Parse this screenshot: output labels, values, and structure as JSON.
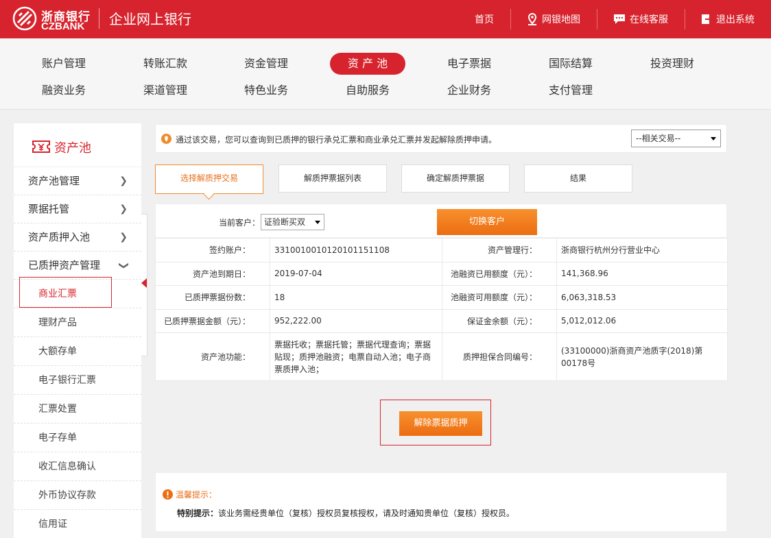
{
  "brand": {
    "name_cn": "浙商银行",
    "name_en": "CZBANK",
    "app_title": "企业网上银行",
    "color": "#d7232d"
  },
  "topnav": [
    {
      "label": "首页",
      "icon": ""
    },
    {
      "label": "网银地图",
      "icon": "location-icon"
    },
    {
      "label": "在线客服",
      "icon": "chat-icon"
    },
    {
      "label": "退出系统",
      "icon": "logout-icon"
    }
  ],
  "mainnav": [
    "账户管理",
    "转账汇款",
    "资金管理",
    "资 产 池",
    "电子票据",
    "国际结算",
    "投资理财",
    "融资业务",
    "渠道管理",
    "特色业务",
    "自助服务",
    "企业财务",
    "支付管理"
  ],
  "sidebar": {
    "title": "资产池",
    "items": [
      "资产池管理",
      "票据托管",
      "资产质押入池",
      "已质押资产管理"
    ],
    "subitems": [
      "商业汇票",
      "理财产品",
      "大额存单",
      "电子银行汇票",
      "汇票处置",
      "电子存单",
      "收汇信息确认",
      "外币协议存款",
      "信用证"
    ]
  },
  "notice": {
    "text": "通过该交易，您可以查询到已质押的银行承兑汇票和商业承兑汇票并发起解除质押申请。",
    "related": "--相关交易--"
  },
  "steps": [
    "选择解质押交易",
    "解质押票据列表",
    "确定解质押票据",
    "结果"
  ],
  "customer": {
    "label": "当前客户：",
    "value": "证验断买双",
    "switch_label": "切换客户"
  },
  "info": {
    "r1": {
      "l1": "签约账户：",
      "v1": "3310010010120101151108",
      "l2": "资产管理行：",
      "v2": "浙商银行杭州分行营业中心"
    },
    "r2": {
      "l1": "资产池到期日：",
      "v1": "2019-07-04",
      "l2": "池融资已用额度（元）：",
      "v2": "141,368.96"
    },
    "r3": {
      "l1": "已质押票据份数：",
      "v1": "18",
      "l2": "池融资可用额度（元）：",
      "v2": "6,063,318.53"
    },
    "r4": {
      "l1": "已质押票据金额（元）：",
      "v1": "952,222.00",
      "l2": "保证金余额（元）：",
      "v2": "5,012,012.06"
    },
    "r5": {
      "l1": "资产池功能：",
      "v1": "票据托收；票据托管；票据代理查询；票据贴现；质押池融资；电票自动入池；电子商票质押入池；",
      "l2": "质押担保合同编号：",
      "v2": "(33100000)浙商资产池质字(2018)第00178号"
    }
  },
  "release_label": "解除票据质押",
  "tips": {
    "title": "温馨提示：",
    "bold": "特别提示：",
    "text": "该业务需经贵单位（复核）授权员复核授权，请及时通知贵单位（复核）授权员。"
  },
  "colors": {
    "accent": "#d7232d",
    "orange": "#ec6d12"
  }
}
